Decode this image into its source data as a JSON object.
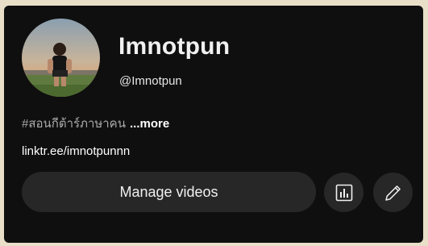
{
  "channel": {
    "name": "Imnotpun",
    "handle": "@Imnotpun"
  },
  "description": {
    "text": "#สอนกีต้าร์ภาษาคน",
    "more_label": "...more"
  },
  "link": {
    "text": "linktr.ee/imnotpunnn"
  },
  "actions": {
    "manage_videos_label": "Manage videos",
    "analytics_icon": "analytics-icon",
    "edit_icon": "pencil-icon"
  },
  "colors": {
    "background": "#0f0f0f",
    "button_background": "#272727",
    "text_primary": "#f1f1f1",
    "text_secondary": "#aaaaaa"
  }
}
